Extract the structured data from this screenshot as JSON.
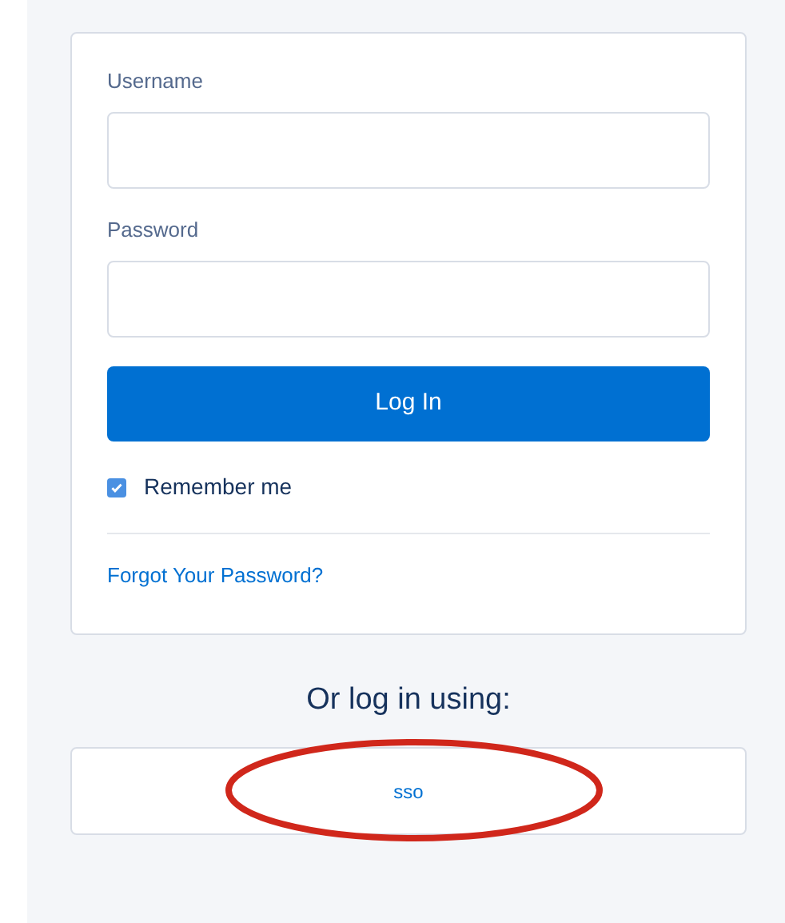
{
  "login_form": {
    "username": {
      "label": "Username"
    },
    "password": {
      "label": "Password"
    },
    "login_button": "Log In",
    "remember_me": {
      "label": "Remember me",
      "checked": true
    },
    "forgot_link": "Forgot Your Password?"
  },
  "alternate_login": {
    "heading": "Or log in using:",
    "providers": [
      {
        "label": "sso",
        "highlighted": true
      }
    ]
  }
}
